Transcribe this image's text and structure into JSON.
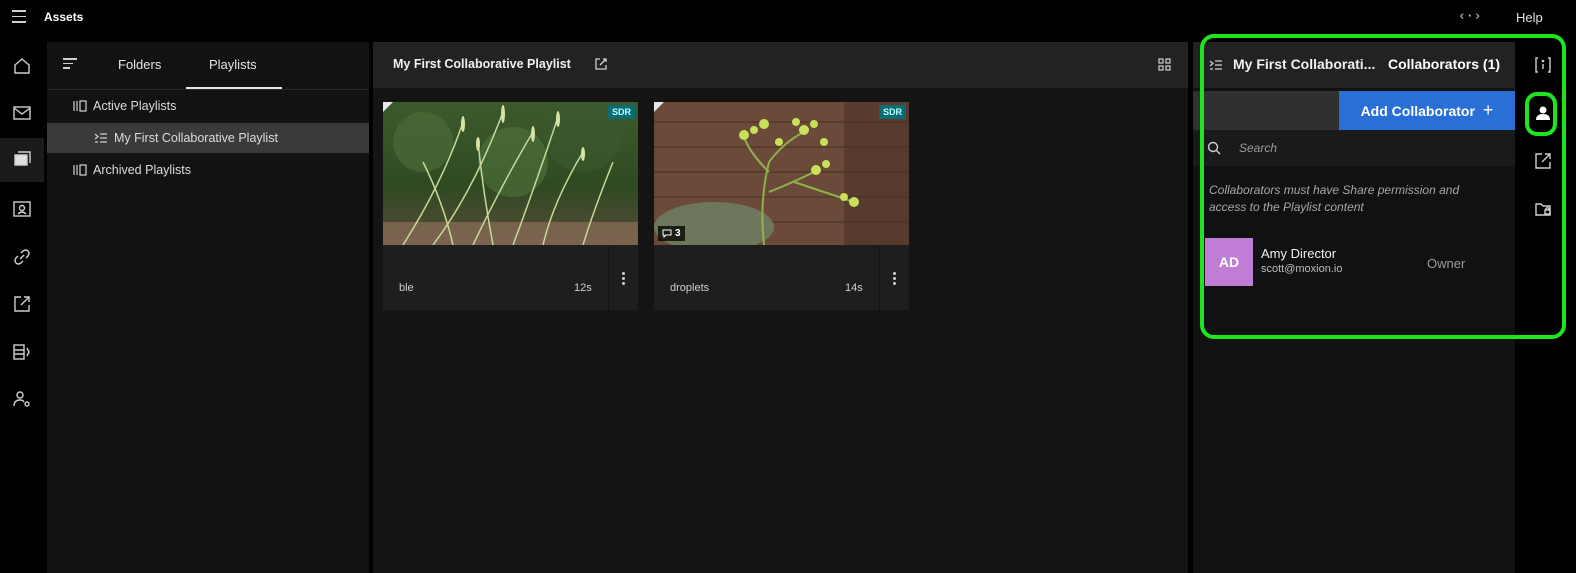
{
  "app": {
    "title": "Assets",
    "code_icon": "‹·›",
    "help_label": "Help"
  },
  "left_nav": {
    "items": [
      {
        "icon": "home-icon"
      },
      {
        "icon": "inbox-icon"
      },
      {
        "icon": "assets-icon",
        "active": true
      },
      {
        "icon": "contacts-icon"
      },
      {
        "icon": "link-icon"
      },
      {
        "icon": "share-icon"
      },
      {
        "icon": "pages-icon"
      },
      {
        "icon": "user-settings-icon"
      }
    ]
  },
  "tree": {
    "tabs": [
      {
        "label": "Folders"
      },
      {
        "label": "Playlists",
        "selected": true
      }
    ],
    "rows": [
      {
        "label": "Active Playlists"
      },
      {
        "label": "My First Collaborative Playlist",
        "selected": true
      },
      {
        "label": "Archived Playlists"
      }
    ]
  },
  "playlist": {
    "title": "My First Collaborative Playlist",
    "items": [
      {
        "name": "ble",
        "duration": "12s",
        "badge": "SDR",
        "comments": ""
      },
      {
        "name": "droplets",
        "duration": "14s",
        "badge": "SDR",
        "comments": "3"
      }
    ]
  },
  "collab_panel": {
    "playlist_title": "My First Collaborati...",
    "collaborators_label": "Collaborators (1)",
    "add_label": "Add Collaborator",
    "add_icon": "+",
    "search_placeholder": "Search",
    "note": "Collaborators must have Share permission and access to the Playlist content",
    "users": [
      {
        "initials": "AD",
        "name": "Amy Director",
        "email": "scott@moxion.io",
        "role": "Owner"
      }
    ]
  },
  "colors": {
    "accent_blue": "#2a6fd6",
    "highlight_green": "#1ee61e",
    "sdr_badge": "#0d6b72",
    "avatar": "#c07dd6"
  }
}
